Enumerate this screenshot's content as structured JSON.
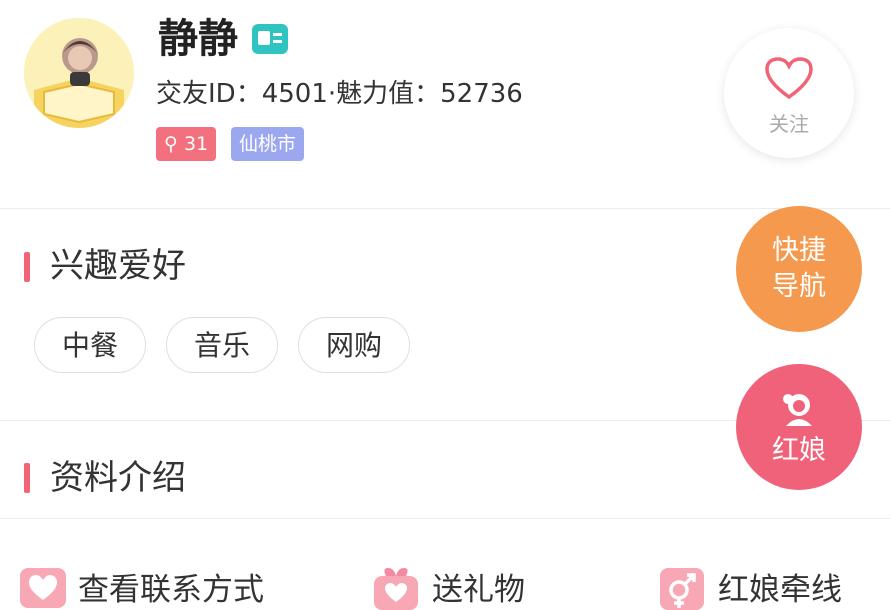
{
  "profile": {
    "name": "静静",
    "ids_line": "交友ID：4501·魅力值：52736",
    "age_tag": "31",
    "city_tag": "仙桃市",
    "follow_label": "关注"
  },
  "sections": {
    "interests_title": "兴趣爱好",
    "interests": [
      "中餐",
      "音乐",
      "网购"
    ],
    "profile_intro_title": "资料介绍"
  },
  "floating": {
    "nav_line1": "快捷",
    "nav_line2": "导航",
    "matchmaker_label": "红娘"
  },
  "actions": {
    "contact": "查看联系方式",
    "gift": "送礼物",
    "matchmaker": "红娘牵线"
  },
  "colors": {
    "accent_pink": "#f16476",
    "orange": "#f4994d",
    "teal_badge": "#2fc4c0",
    "city_tag": "#9ba7ee"
  }
}
